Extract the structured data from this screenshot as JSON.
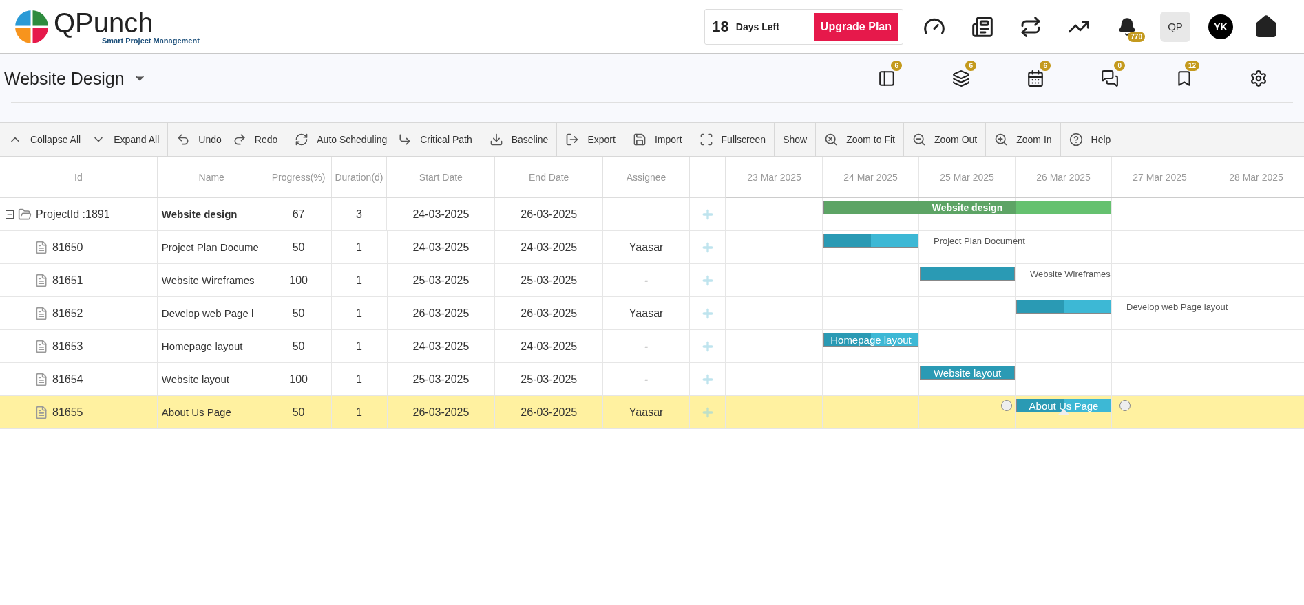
{
  "brand": {
    "name": "QPunch",
    "tagline": "Smart Project Management"
  },
  "plan": {
    "days": "18",
    "days_label": "Days Left",
    "upgrade": "Upgrade Plan"
  },
  "header_icons": {
    "notifications": "770",
    "user_initials": "QP",
    "avatar_initials": "YK"
  },
  "project": {
    "title": "Website Design",
    "badges": [
      "6",
      "6",
      "6",
      "0",
      "12"
    ]
  },
  "toolbar": [
    [
      "Collapse All",
      "Expand All"
    ],
    [
      "Undo",
      "Redo"
    ],
    [
      "Auto Scheduling",
      "Critical Path"
    ],
    [
      "Baseline"
    ],
    [
      "Export"
    ],
    [
      "Import"
    ],
    [
      "Fullscreen"
    ],
    [
      "Show"
    ],
    [
      "Zoom to Fit"
    ],
    [
      "Zoom Out"
    ],
    [
      "Zoom In"
    ],
    [
      "Help"
    ]
  ],
  "table": {
    "columns": [
      "Id",
      "Name",
      "Progress(%)",
      "Duration(d)",
      "Start Date",
      "End Date",
      "Assignee"
    ],
    "rows": [
      {
        "kind": "project",
        "expanded": true,
        "selected": false,
        "id": "ProjectId :1891",
        "name": "Website design",
        "progress": "67",
        "duration": "3",
        "start": "24-03-2025",
        "end": "26-03-2025",
        "assignee": "",
        "bar": {
          "label": "Website design",
          "label_inside": true
        }
      },
      {
        "kind": "task",
        "selected": false,
        "id": "81650",
        "name": "Project Plan Docume",
        "progress": "50",
        "duration": "1",
        "start": "24-03-2025",
        "end": "24-03-2025",
        "assignee": "Yaasar",
        "bar": {
          "label": "Project Plan Document",
          "label_inside": false
        }
      },
      {
        "kind": "task",
        "selected": false,
        "id": "81651",
        "name": "Website Wireframes",
        "progress": "100",
        "duration": "1",
        "start": "25-03-2025",
        "end": "25-03-2025",
        "assignee": "-",
        "bar": {
          "label": "Website Wireframes",
          "label_inside": false
        }
      },
      {
        "kind": "task",
        "selected": false,
        "id": "81652",
        "name": "Develop web Page l",
        "progress": "50",
        "duration": "1",
        "start": "26-03-2025",
        "end": "26-03-2025",
        "assignee": "Yaasar",
        "bar": {
          "label": "Develop web Page layout",
          "label_inside": false
        }
      },
      {
        "kind": "task",
        "selected": false,
        "id": "81653",
        "name": "Homepage layout",
        "progress": "50",
        "duration": "1",
        "start": "24-03-2025",
        "end": "24-03-2025",
        "assignee": "-",
        "bar": {
          "label": "Homepage layout",
          "label_inside": true
        }
      },
      {
        "kind": "task",
        "selected": false,
        "id": "81654",
        "name": "Website layout",
        "progress": "100",
        "duration": "1",
        "start": "25-03-2025",
        "end": "25-03-2025",
        "assignee": "-",
        "bar": {
          "label": "Website layout",
          "label_inside": true
        }
      },
      {
        "kind": "task",
        "selected": true,
        "id": "81655",
        "name": "About Us Page",
        "progress": "50",
        "duration": "1",
        "start": "26-03-2025",
        "end": "26-03-2025",
        "assignee": "Yaasar",
        "bar": {
          "label": "About Us Page",
          "label_inside": true
        }
      }
    ]
  },
  "gantt": {
    "days": [
      "23 Mar 2025",
      "24 Mar 2025",
      "25 Mar 2025",
      "26 Mar 2025",
      "27 Mar 2025",
      "28 Mar 2025"
    ]
  }
}
